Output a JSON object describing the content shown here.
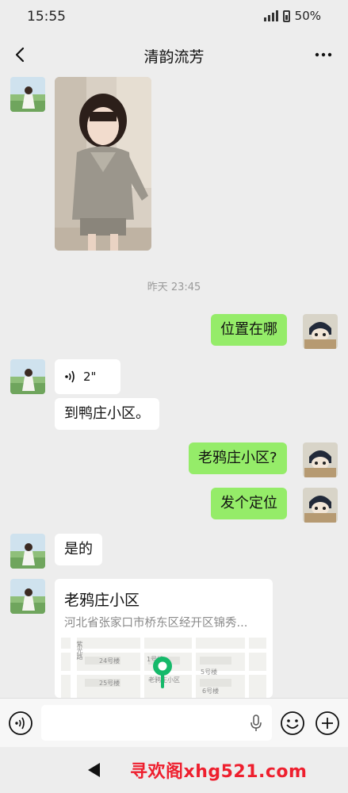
{
  "status_bar": {
    "time": "15:55",
    "battery": "50%"
  },
  "header": {
    "title": "清韵流芳"
  },
  "messages": {
    "timestamp": "昨天 23:45",
    "m1": "位置在哪",
    "voice_duration": "2\"",
    "m2": "到鸭庄小区。",
    "m3": "老鸦庄小区?",
    "m4": "发个定位",
    "m5": "是的"
  },
  "location": {
    "name": "老鸦庄小区",
    "address": "河北省张家口市桥东区经开区锦秀...",
    "map_labels": [
      "24号楼",
      "25号楼",
      "5号楼",
      "6号楼",
      "老鸦庄小区",
      "1号楼"
    ],
    "street": "紫光路"
  },
  "input": {
    "placeholder": ""
  },
  "footer": {
    "watermark": "寻欢阁xhg521.com"
  },
  "colors": {
    "sent_bubble": "#95ec69",
    "received_bubble": "#ffffff",
    "background": "#ededed",
    "map_pin": "#15b96a",
    "watermark": "#ee1f2e"
  },
  "icons": [
    "back-arrow-icon",
    "more-dots-icon",
    "voice-wave-icon",
    "microphone-icon",
    "emoji-icon",
    "plus-icon",
    "location-pin-icon",
    "nav-back-triangle-icon"
  ]
}
